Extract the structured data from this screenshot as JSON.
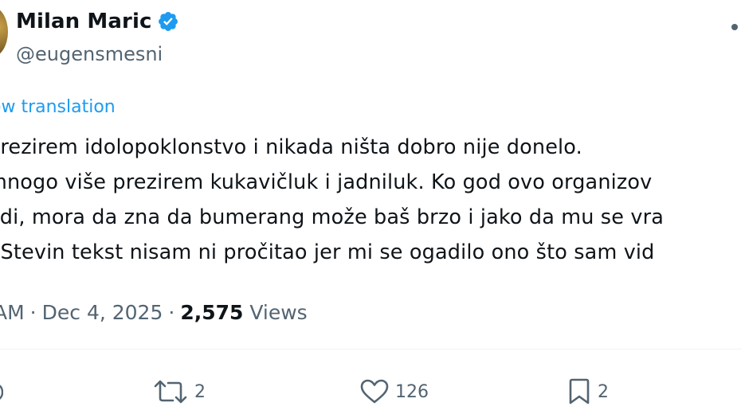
{
  "author": {
    "display_name": "Milan Maric",
    "handle": "@eugensmesni",
    "verified": true
  },
  "translation": {
    "label": "ow translation"
  },
  "tweet": {
    "lines": [
      "prezirem idolopoklonstvo i nikada ništa dobro nije donelo.",
      "mnogo više prezirem kukavičluk i jadniluk. Ko god ovo organizov",
      "adi, mora da zna da bumerang može baš brzo i jako da mu se vra",
      ". Stevin tekst nisam ni pročitao jer mi se ogadilo ono što sam vid"
    ]
  },
  "meta": {
    "time": "AM",
    "separator": "·",
    "date": "Dec 4, 2025",
    "views_count": "2,575",
    "views_label": "Views"
  },
  "actions": {
    "reposts": "2",
    "likes": "126",
    "bookmarks": "2"
  },
  "colors": {
    "accent": "#1d9bf0",
    "text": "#0f1419",
    "muted": "#536471"
  },
  "icons": {
    "verified": "verified-badge-icon",
    "repost": "repost-icon",
    "like": "heart-icon",
    "bookmark": "bookmark-icon",
    "more": "more-icon",
    "reply": "reply-icon"
  }
}
